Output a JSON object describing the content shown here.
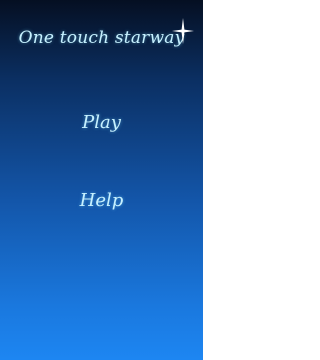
{
  "title": "One touch starway",
  "menu": {
    "play_label": "Play",
    "help_label": "Help"
  },
  "decor": {
    "star_icon": "sparkle-star-icon"
  },
  "colors": {
    "text": "#c7f1ff",
    "bg_top": "#050f22",
    "bg_bottom": "#1d86f2"
  }
}
